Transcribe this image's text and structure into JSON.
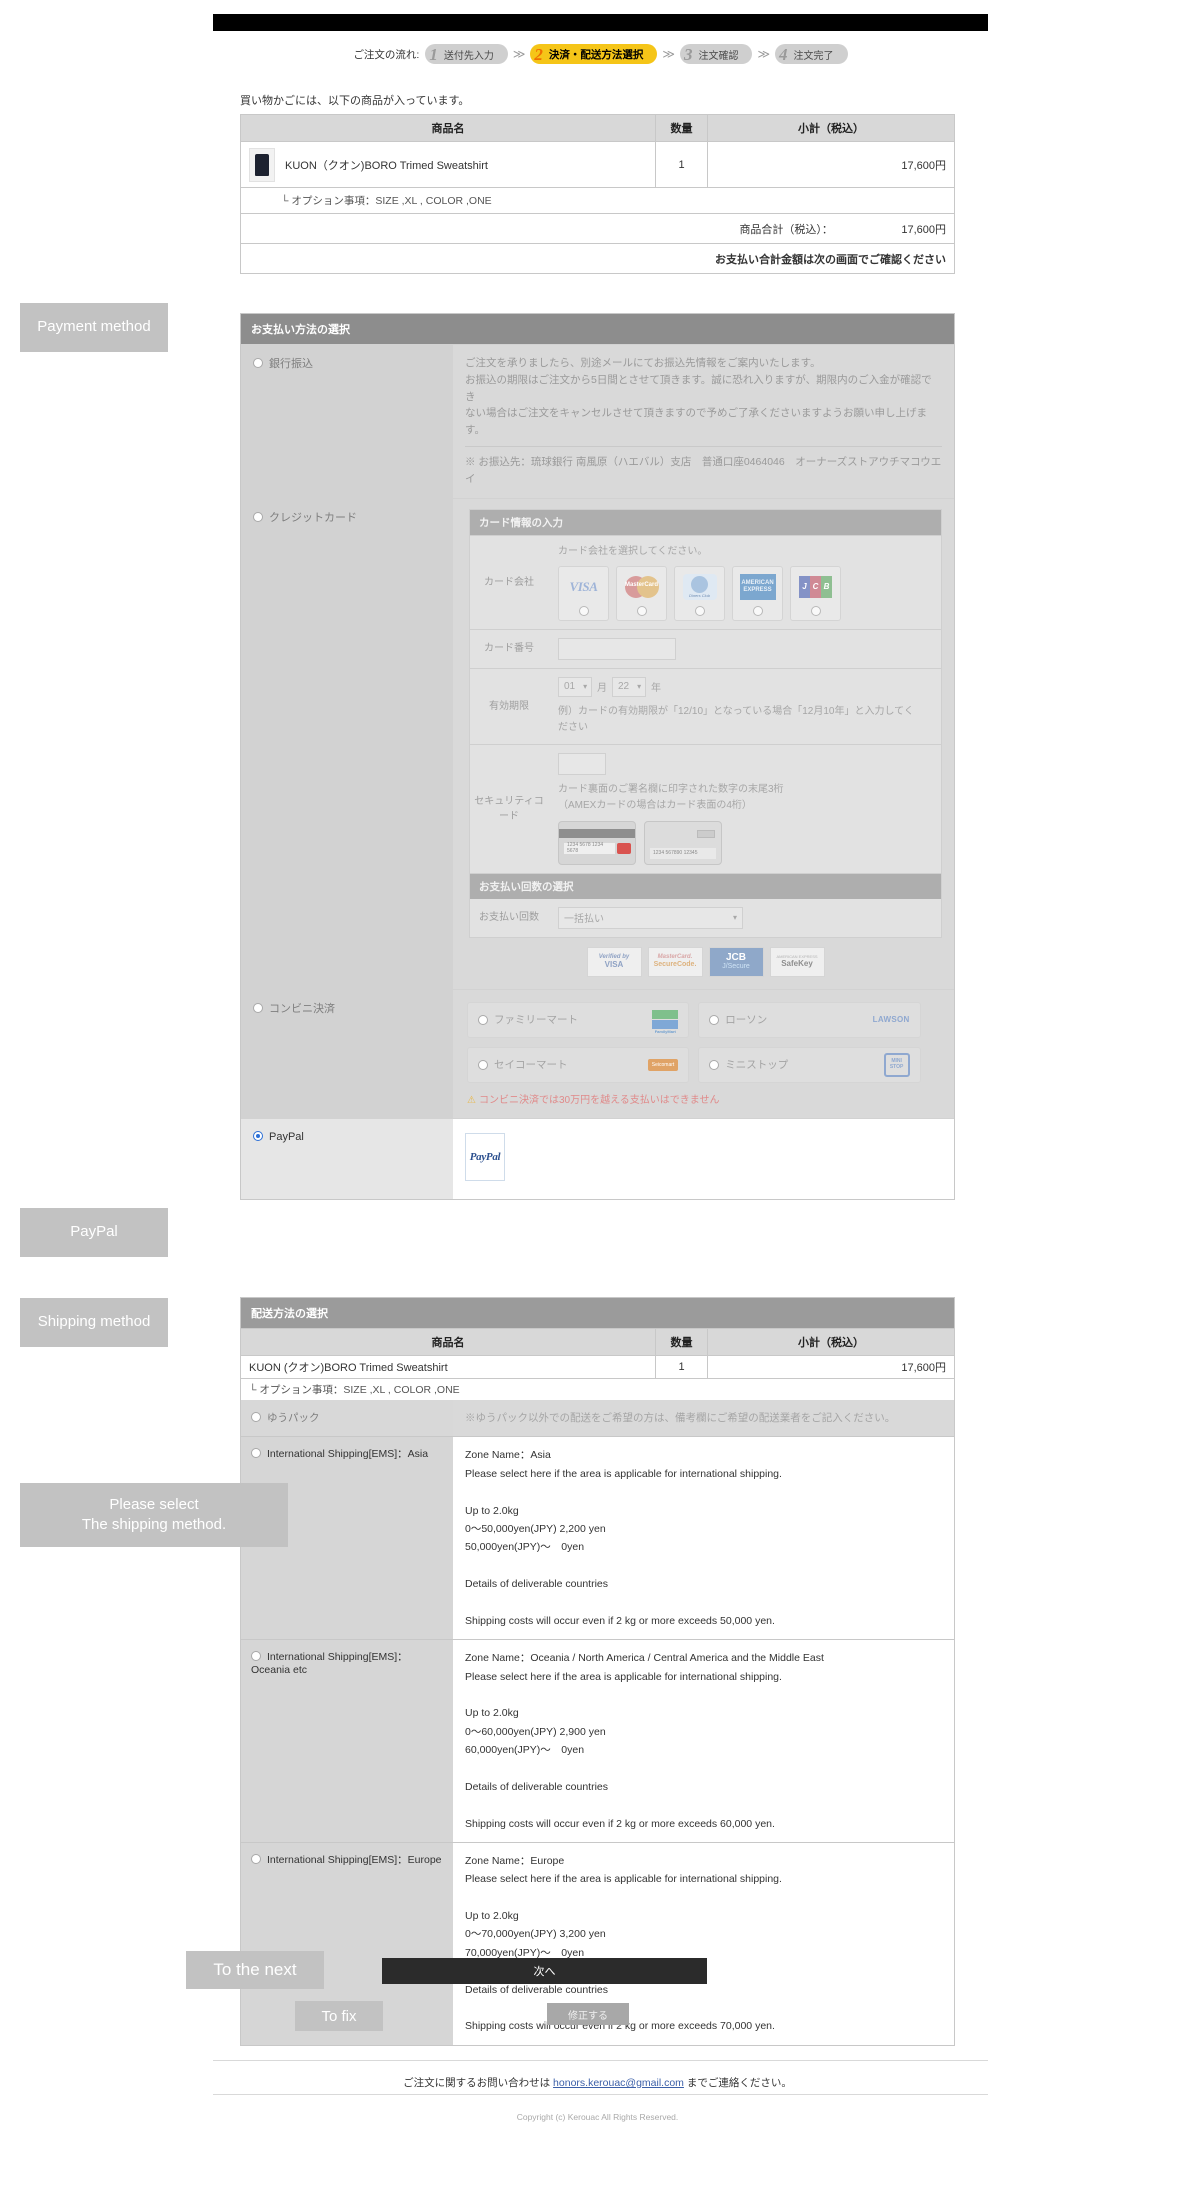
{
  "steps": {
    "label": "ご注文の流れ:",
    "items": [
      {
        "num": "1",
        "text": "送付先入力",
        "active": false
      },
      {
        "num": "2",
        "text": "決済・配送方法選択",
        "active": true
      },
      {
        "num": "3",
        "text": "注文確認",
        "active": false
      },
      {
        "num": "4",
        "text": "注文完了",
        "active": false
      }
    ],
    "separator": "≫"
  },
  "cart": {
    "note": "買い物かごには、以下の商品が入っています。",
    "headers": [
      "商品名",
      "数量",
      "小計（税込）"
    ],
    "item_name": "KUON（クオン)BORO Trimed Sweatshirt",
    "item_qty": "1",
    "item_subtotal": "17,600円",
    "option_text": "└ オプション事項：SIZE ,XL , COLOR ,ONE",
    "total_label": "商品合計（税込）：",
    "total_value": "17,600円",
    "payment_notice": "お支払い合計金額は次の画面でご確認ください"
  },
  "payment": {
    "section_title": "お支払い方法の選択",
    "bank": {
      "label": "銀行振込",
      "desc_line1": "ご注文を承りましたら、別途メールにてお振込先情報をご案内いたします。",
      "desc_line2": "お振込の期限はご注文から5日間とさせて頂きます。誠に恐れ入りますが、期限内のご入金が確認でき",
      "desc_line3": "ない場合はご注文をキャンセルさせて頂きますので予めご了承くださいますようお願い申し上げます。",
      "account": "※ お振込先：琉球銀行 南風原（ハエバル）支店　普通口座0464046　オーナーズストアウチマコウエ",
      "account2": "イ"
    },
    "credit": {
      "label": "クレジットカード",
      "box_title": "カード情報の入力",
      "company_label": "カード会社",
      "company_hint": "カード会社を選択してください。",
      "brands": [
        "VISA",
        "MasterCard",
        "Diners Club International",
        "AMERICAN EXPRESS",
        "JCB"
      ],
      "number_label": "カード番号",
      "expiry_label": "有効期限",
      "expiry_month": "01",
      "expiry_month_unit": "月",
      "expiry_year": "22",
      "expiry_year_unit": "年",
      "expiry_hint1": "例）カードの有効期限が「12/10」となっている場合「12月10年」と入力してく",
      "expiry_hint2": "ださい",
      "security_label": "セキュリティコード",
      "security_hint1": "カード裏面のご署名欄に印字された数字の末尾3桁",
      "security_hint2": "（AMEXカードの場合はカード表面の4桁）",
      "cvv_card_text": "1234 5678 1234 5678",
      "cvv_amex_text": "1234 567890 12345",
      "installments_title": "お支払い回数の選択",
      "installments_label": "お支払い回数",
      "installments_value": "一括払い",
      "secure_badges": [
        "Verified by VISA",
        "MasterCard SecureCode.",
        "JCB J/Secure",
        "AMERICAN EXPRESS SafeKey"
      ]
    },
    "konbini": {
      "label": "コンビニ決済",
      "stores": [
        "ファミリーマート",
        "ローソン",
        "セイコーマート",
        "ミニストップ"
      ],
      "warning": "コンビニ決済では30万円を越える支払いはできません"
    },
    "paypal": {
      "label": "PayPal",
      "logo_text": "PayPal"
    }
  },
  "shipping": {
    "section_title": "配送方法の選択",
    "headers": [
      "商品名",
      "数量",
      "小計（税込）"
    ],
    "item_name": "KUON (クオン)BORO Trimed Sweatshirt",
    "item_qty": "1",
    "item_subtotal": "17,600円",
    "option_text": "└ オプション事項：SIZE ,XL , COLOR ,ONE",
    "options": [
      {
        "label": "ゆうパック",
        "selected": false,
        "disabled": true,
        "desc": "※ゆうパック以外での配送をご希望の方は、備考欄にご希望の配送業者をご記入ください。"
      },
      {
        "label": "International Shipping[EMS]：Asia",
        "selected": false,
        "disabled": false,
        "desc": "Zone Name：Asia\nPlease select here if the area is applicable for international shipping.\n\nUp to 2.0kg\n0〜50,000yen(JPY) 2,200 yen\n50,000yen(JPY)〜　0yen\n\nDetails of deliverable countries\n\nShipping costs will occur even if 2 kg or more exceeds 50,000 yen."
      },
      {
        "label": "International Shipping[EMS]：Oceania etc",
        "selected": false,
        "disabled": false,
        "desc": "Zone Name：Oceania / North America / Central America and the Middle East\nPlease select here if the area is applicable for international shipping.\n\nUp to 2.0kg\n0〜60,000yen(JPY) 2,900 yen\n60,000yen(JPY)〜　0yen\n\nDetails of deliverable countries\n\nShipping costs will occur even if 2 kg or more exceeds 60,000 yen."
      },
      {
        "label": "International Shipping[EMS]：Europe",
        "selected": false,
        "disabled": false,
        "desc": "Zone Name：Europe\nPlease select here if the area is applicable for international shipping.\n\nUp to 2.0kg\n0〜70,000yen(JPY) 3,200 yen\n70,000yen(JPY)〜　0yen\n\nDetails of deliverable countries\n\nShipping costs will occur even if 2 kg or more exceeds 70,000 yen."
      }
    ]
  },
  "buttons": {
    "next": "次へ",
    "fix": "修正する"
  },
  "footer": {
    "contact_prefix": "ご注文に関するお問い合わせは ",
    "email": "honors.kerouac@gmail.com",
    "contact_suffix": " までご連絡ください。",
    "copyright": "Copyright (c) Kerouac All Rights Reserved."
  },
  "annotations": {
    "payment_method": "Payment method",
    "paypal": "PayPal",
    "shipping_method": "Shipping method",
    "please_select_l1": "Please select",
    "please_select_l2": "The shipping method.",
    "to_the_next": "To the next",
    "to_fix": "To fix"
  }
}
